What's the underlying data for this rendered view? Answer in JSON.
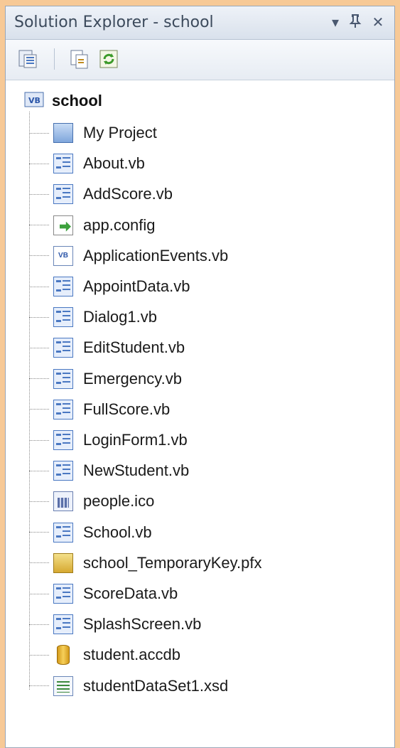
{
  "window": {
    "title": "Solution Explorer - school",
    "dropdown_glyph": "▾",
    "pin_glyph": "ᵖ",
    "close_glyph": "✕"
  },
  "toolbar": {
    "buttons": [
      {
        "name": "properties-icon"
      },
      {
        "name": "show-all-files-icon"
      },
      {
        "name": "refresh-icon"
      }
    ]
  },
  "tree": {
    "root": {
      "label": "school",
      "icon": "vb-project-icon"
    },
    "items": [
      {
        "label": "My Project",
        "icon": "my-project-icon"
      },
      {
        "label": "About.vb",
        "icon": "form-icon"
      },
      {
        "label": "AddScore.vb",
        "icon": "form-icon"
      },
      {
        "label": "app.config",
        "icon": "config-icon"
      },
      {
        "label": "ApplicationEvents.vb",
        "icon": "vb-file-icon"
      },
      {
        "label": "AppointData.vb",
        "icon": "form-icon"
      },
      {
        "label": "Dialog1.vb",
        "icon": "form-icon"
      },
      {
        "label": "EditStudent.vb",
        "icon": "form-icon"
      },
      {
        "label": "Emergency.vb",
        "icon": "form-icon"
      },
      {
        "label": "FullScore.vb",
        "icon": "form-icon"
      },
      {
        "label": "LoginForm1.vb",
        "icon": "form-icon"
      },
      {
        "label": "NewStudent.vb",
        "icon": "form-icon"
      },
      {
        "label": "people.ico",
        "icon": "ico-file-icon"
      },
      {
        "label": "School.vb",
        "icon": "form-icon"
      },
      {
        "label": "school_TemporaryKey.pfx",
        "icon": "key-icon"
      },
      {
        "label": "ScoreData.vb",
        "icon": "form-icon"
      },
      {
        "label": "SplashScreen.vb",
        "icon": "form-icon"
      },
      {
        "label": "student.accdb",
        "icon": "database-icon"
      },
      {
        "label": "studentDataSet1.xsd",
        "icon": "dataset-icon"
      }
    ]
  }
}
